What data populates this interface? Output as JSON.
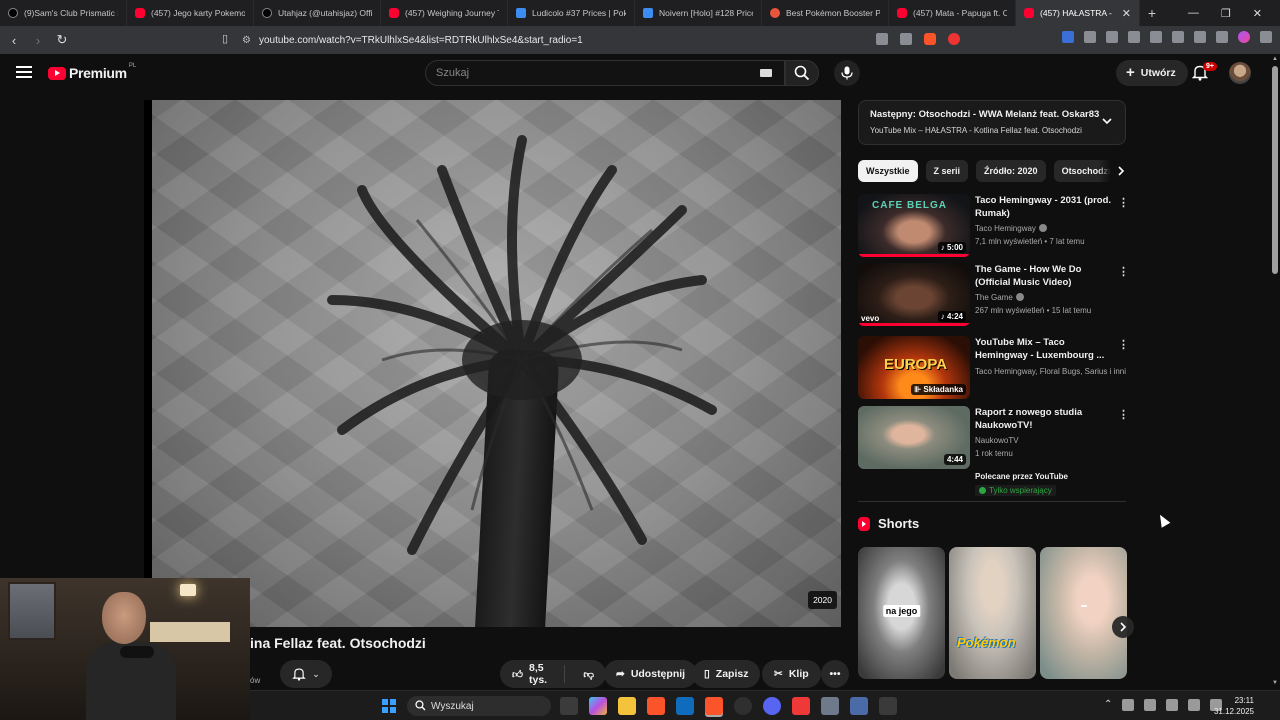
{
  "browser": {
    "tabs": [
      {
        "label": "(9)Sam's Club Prismatic ET",
        "icon": "tiktok"
      },
      {
        "label": "(457) Jego karty Pokemon",
        "icon": "youtube"
      },
      {
        "label": "Utahjaz (@utahisjaz) Offic",
        "icon": "tiktok"
      },
      {
        "label": "(457) Weighing Journey To",
        "icon": "youtube"
      },
      {
        "label": "Ludicolo #37 Prices | Poke",
        "icon": "blue"
      },
      {
        "label": "Noivern [Holo] #128 Price",
        "icon": "blue"
      },
      {
        "label": "Best Pokémon Booster Pa",
        "icon": "orange"
      },
      {
        "label": "(457) Mata - Papuga ft. Ot",
        "icon": "youtube"
      },
      {
        "label": "(457) HAŁASTRA -",
        "icon": "youtube",
        "active": true
      }
    ],
    "url": "youtube.com/watch?v=TRkUlhlxSe4&list=RDTRkUlhlxSe4&start_radio=1"
  },
  "youtube": {
    "brand": "Premium",
    "country": "PL",
    "search_placeholder": "Szukaj",
    "create_label": "Utwórz",
    "notif_badge": "9+"
  },
  "video": {
    "year_label": "2020",
    "title_visible": "ina Fellaz feat. Otsochodzi",
    "channel_fragment": "ów",
    "likes": "8,5 tys.",
    "share_label": "Udostępnij",
    "save_label": "Zapisz",
    "clip_label": "Klip"
  },
  "upnext": {
    "title": "Następny: Otsochodzi - WWA Melanż feat. Oskar83",
    "subtitle": "YouTube Mix – HAŁASTRA - Kotlina Fellaz feat. Otsochodzi"
  },
  "chips": [
    "Wszystkie",
    "Z serii",
    "Źródło: 2020",
    "Otsochodzi"
  ],
  "recommendations": [
    {
      "title": "Taco Hemingway - 2031 (prod. Rumak)",
      "channel": "Taco Hemingway",
      "verified": true,
      "stats": "7,1 mln wyświetleń • 7 lat temu",
      "duration": "5:00",
      "thumb_text": "CAFE BELGA"
    },
    {
      "title": "The Game - How We Do (Official Music Video)",
      "channel": "The Game",
      "verified": true,
      "stats": "267 mln wyświetleń • 15 lat temu",
      "duration": "4:24",
      "thumb_text": "vevo"
    },
    {
      "title": "YouTube Mix – Taco Hemingway - Luxembourg ...",
      "channel": "Taco Hemingway, Floral Bugs, Sarius i inni",
      "stats": "",
      "duration": "Składanka",
      "thumb_text": "EUROPA"
    },
    {
      "title": "Raport z nowego studia NaukowoTV!",
      "channel": "NaukowoTV",
      "stats": "1 rok temu",
      "duration": "4:44",
      "recommended": "Polecane przez YouTube",
      "members": "Tylko wspierający"
    }
  ],
  "shorts": {
    "heading": "Shorts",
    "items": [
      {
        "caption": "na jego"
      },
      {
        "caption": "Pokémon"
      },
      {
        "caption": ""
      }
    ]
  },
  "taskbar": {
    "search_placeholder": "Wyszukaj",
    "time": "23:11",
    "date": "31.12.2025"
  }
}
